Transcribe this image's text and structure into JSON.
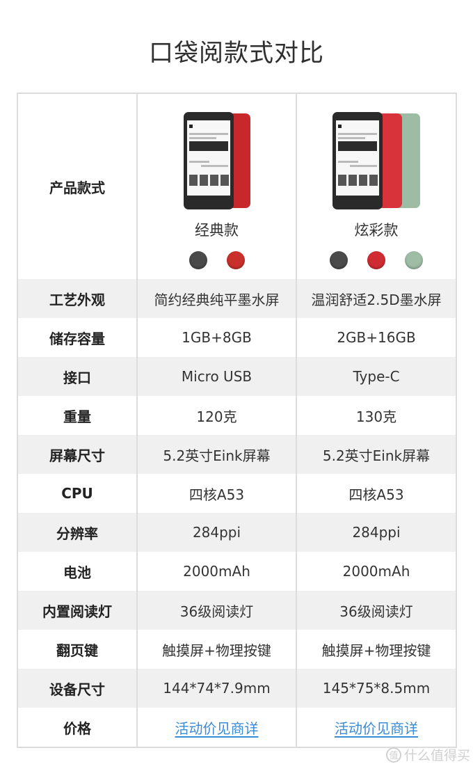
{
  "title": "口袋阅款式对比",
  "header_row": {
    "label": "产品款式",
    "models": [
      {
        "name": "经典款",
        "device_colors": [
          "#c7282b"
        ],
        "swatches": [
          {
            "name": "black",
            "color": "#4a4a4a"
          },
          {
            "name": "red",
            "color": "#c9302c"
          }
        ]
      },
      {
        "name": "炫彩款",
        "device_colors": [
          "#d8323a",
          "#9dbca3"
        ],
        "swatches": [
          {
            "name": "black",
            "color": "#4a4a4a"
          },
          {
            "name": "red",
            "color": "#cf2b33"
          },
          {
            "name": "green",
            "color": "#9fbda5"
          }
        ]
      }
    ]
  },
  "rows": [
    {
      "label": "工艺外观",
      "classic": "简约经典纯平墨水屏",
      "color": "温润舒适2.5D墨水屏"
    },
    {
      "label": "储存容量",
      "classic": "1GB+8GB",
      "color": "2GB+16GB"
    },
    {
      "label": "接口",
      "classic": "Micro USB",
      "color": "Type-C"
    },
    {
      "label": "重量",
      "classic": "120克",
      "color": "130克"
    },
    {
      "label": "屏幕尺寸",
      "classic": "5.2英寸Eink屏幕",
      "color": "5.2英寸Eink屏幕"
    },
    {
      "label": "CPU",
      "classic": "四核A53",
      "color": "四核A53"
    },
    {
      "label": "分辨率",
      "classic": "284ppi",
      "color": "284ppi"
    },
    {
      "label": "电池",
      "classic": "2000mAh",
      "color": "2000mAh"
    },
    {
      "label": "内置阅读灯",
      "classic": "36级阅读灯",
      "color": "36级阅读灯"
    },
    {
      "label": "翻页键",
      "classic": "触摸屏+物理按键",
      "color": "触摸屏+物理按键"
    },
    {
      "label": "设备尺寸",
      "classic": "144*74*7.9mm",
      "color": "145*75*8.5mm"
    },
    {
      "label": "价格",
      "classic": "活动价见商详",
      "color": "活动价见商详"
    }
  ],
  "link_color": "#3a8ad6",
  "watermark": {
    "icon": "值",
    "text": "什么值得买"
  }
}
